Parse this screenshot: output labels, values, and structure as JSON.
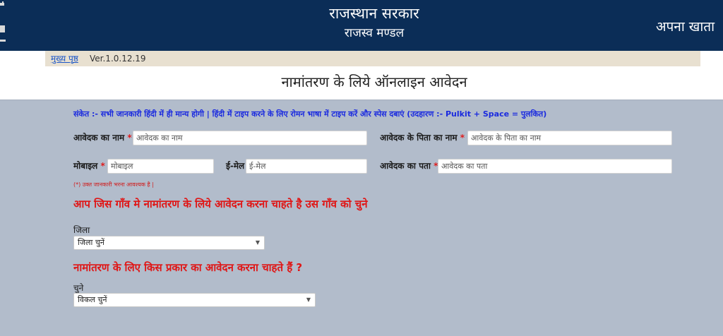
{
  "header": {
    "title": "राजस्थान सरकार",
    "subtitle": "राजस्व मण्डल",
    "account_label": "अपना खाता"
  },
  "nav": {
    "home_link": "मुख्य पृष्ठ",
    "version": "Ver.1.0.12.19"
  },
  "page_title": "नामांतरण के लिये ऑनलाइन आवेदन",
  "notice": "संकेत :- सभी जानकारी हिंदी में ही मान्य होगी | हिंदी में टाइप करने के लिए रोमन भाषा में टाइप करें और स्पेस दबाएं (उदहारण :- Pulkit + Space = पुलकित)",
  "form": {
    "applicant_name": {
      "label": "आवेदक का नाम",
      "required_mark": "*",
      "value": "",
      "placeholder": "आवेदक का नाम"
    },
    "father_name": {
      "label": "आवेदक के पिता का नाम",
      "required_mark": "*",
      "value": "",
      "placeholder": "आवेदक के पिता का नाम"
    },
    "mobile": {
      "label": "मोबाइल",
      "required_mark": "*",
      "value": "",
      "placeholder": "मोबाइल"
    },
    "email": {
      "label": "ई-मेल",
      "value": "",
      "placeholder": "ई-मेल"
    },
    "address": {
      "label": "आवेदक का पता",
      "required_mark": "*",
      "value": "",
      "placeholder": "आवेदक का पता"
    },
    "required_hint": "(*) उक्त जानकारी भरना आवश्यक है |"
  },
  "village_section": {
    "title": "आप जिस गाँव मे नामांतरण के लिये आवेदन करना चाहते है उस गाँव को चुने",
    "district_label": "जिला",
    "district_selected": "जिला चुनें"
  },
  "type_section": {
    "title": "नामांतरण के लिए किस प्रकार का आवेदन करना चाहते हैं ?",
    "choose_label": "चुने",
    "option_selected": "विकल चुनें"
  },
  "colors": {
    "header_bg": "#0b2d57",
    "form_bg": "#b2bccb",
    "notice_text": "#1a2adf",
    "section_title": "#e01515",
    "required": "#e01c1c"
  }
}
